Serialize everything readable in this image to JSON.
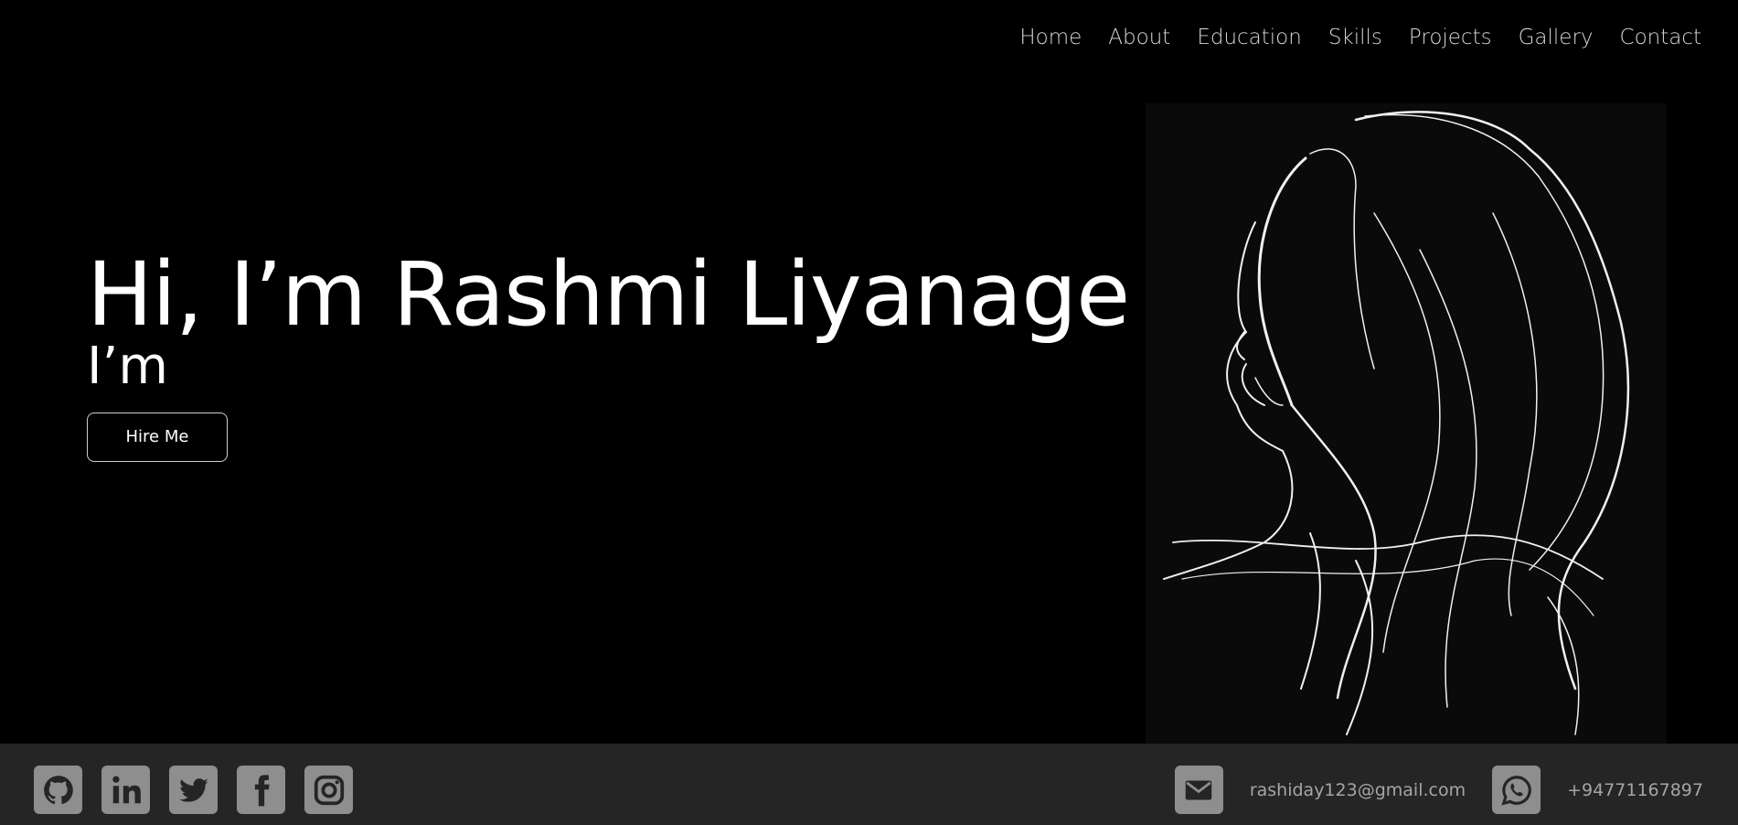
{
  "nav": {
    "items": [
      "Home",
      "About",
      "Education",
      "Skills",
      "Projects",
      "Gallery",
      "Contact"
    ]
  },
  "hero": {
    "title": "Hi, I’m Rashmi Liyanage",
    "subtitle": "I’m",
    "button": "Hire Me"
  },
  "portrait": {
    "icon": "line-art-woman-profile"
  },
  "footer": {
    "socials": [
      "github-icon",
      "linkedin-icon",
      "twitter-icon",
      "facebook-icon",
      "instagram-icon"
    ],
    "email": "rashiday123@gmail.com",
    "phone": "+94771167897"
  },
  "colors": {
    "background": "#000000",
    "footer": "#252525",
    "icon": "#8e8e8e"
  }
}
